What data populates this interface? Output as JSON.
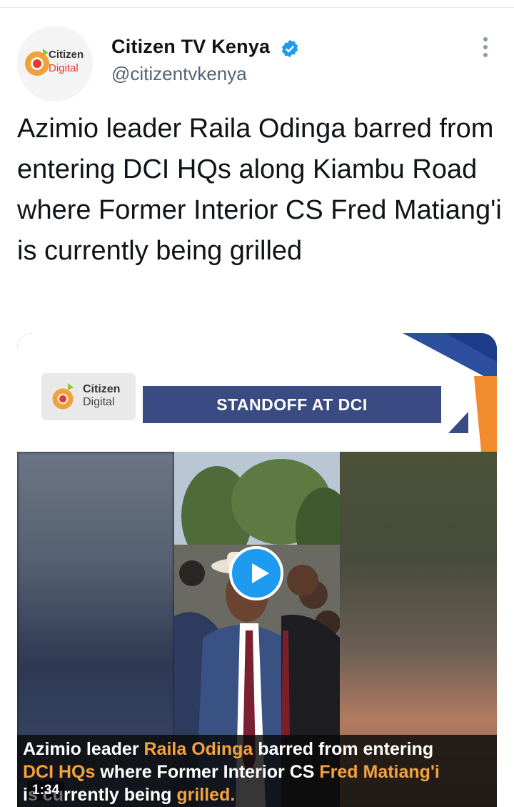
{
  "account": {
    "name": "Citizen TV Kenya",
    "handle": "@citizentvkenya",
    "avatar": {
      "logo_line1": "Citizen",
      "logo_line2": "Digital"
    }
  },
  "tweet": {
    "text": "Azimio leader Raila Odinga barred from entering DCI HQs along Kiambu Road where Former Interior CS Fred Matiang'i is currently being grilled"
  },
  "media": {
    "logo_line1": "Citizen",
    "logo_line2": "Digital",
    "banner_title": "STANDOFF AT DCI",
    "caption": {
      "l1_a": "Azimio leader ",
      "l1_b": "Raila Odinga",
      "l1_c": " barred from entering",
      "l2_a": "DCI HQs",
      "l2_b": " where Former Interior CS ",
      "l2_c": "Fred Matiang'i",
      "l3_a": "is currently being ",
      "l3_b": "grilled."
    },
    "duration": "1:34"
  },
  "colors": {
    "verified": "#1d9bf0",
    "accent_orange": "#f4a23c",
    "banner_blue": "#3a4a82"
  },
  "icons": {
    "verified": "verified-badge-icon",
    "more": "more-vertical-icon",
    "play": "play-icon"
  }
}
